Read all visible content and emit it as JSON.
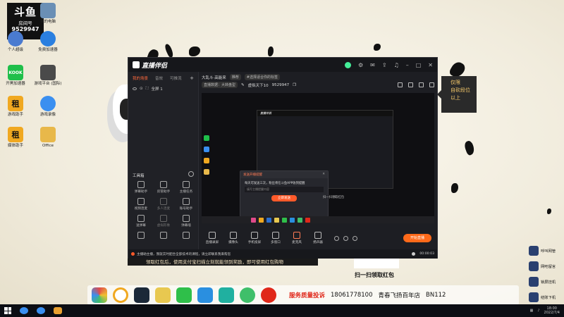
{
  "desktop": {
    "room_box": {
      "logo": "斗鱼",
      "label": "房间号",
      "number": "9529947"
    },
    "icons": [
      {
        "label": "我的电脑"
      },
      {
        "label": "个人超级"
      },
      {
        "label": "免费加速器"
      },
      {
        "label": "开黑加速器"
      },
      {
        "label": "游戏平台 (国际)"
      },
      {
        "label": "游戏助手"
      },
      {
        "label": "游戏录像"
      },
      {
        "label": "媒体助手"
      },
      {
        "label": "Office"
      }
    ]
  },
  "app": {
    "title": "直播伴侣",
    "left_tabs": [
      "我的场景",
      "音效",
      "可推流"
    ],
    "scene": "全屏 1",
    "toolbox": {
      "title": "工具箱",
      "tools": [
        "弹幕助手",
        "房管助手",
        "主播任务",
        "视频连麦",
        "多人连麦",
        "账号助手",
        "送弹幕",
        "虚拟形象",
        "弹幕墙",
        "",
        "",
        ""
      ]
    },
    "info": {
      "stream_title": "大乱斗·高能来",
      "category_pill": "推荐",
      "tag_pill": "#选择适合你的标签",
      "platform_pill": "直播数据：大转盘型",
      "sub_label": "虚拟天下10",
      "room_id": "9529947"
    },
    "preview": {
      "nested_title": "直播伴侣",
      "popup_title": "发送开播提醒",
      "popup_msg": "每天可发送三次，粉丝将在斗鱼APP收到提醒",
      "popup_input_placeholder": "填写主播提醒内容",
      "popup_button": "立即发送",
      "caption": "扫一扫领取红包"
    },
    "controls": [
      "直播录屏",
      "摄像头",
      "手机投屏",
      "多窗口",
      "麦克风",
      "扬声器"
    ],
    "live_button": "开始直播",
    "status_message": "主播助主播，我就实时配合全部技术的课程，请立即联系我来帮您",
    "timer": "00:00:03"
  },
  "notice": {
    "lines": [
      "仅限",
      "自砍段位",
      "以上"
    ]
  },
  "banner": {
    "text": "领取红包后，使用支付宝扫描立刻就能领到奖励，即可使用红包购物",
    "qr_caption": "扫一扫领取红包"
  },
  "dock_ad": {
    "label": "服务质量投诉",
    "phone": "18061778100",
    "shop": "青春飞扬百年店",
    "code": "BN112"
  },
  "side_widgets": [
    "呼叫网管",
    "网吧留言",
    "锁屏挂机",
    "结账下机"
  ],
  "taskbar": {
    "time": "18:00",
    "date": "2022/7/4"
  }
}
